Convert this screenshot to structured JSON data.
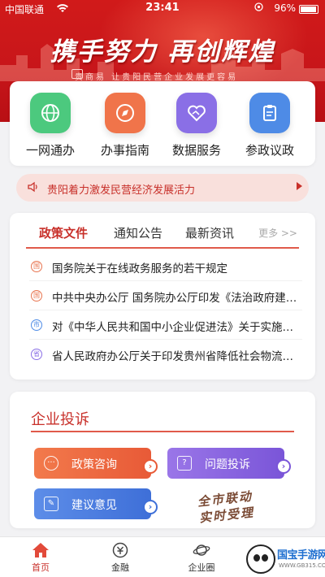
{
  "status_bar": {
    "carrier": "中国联通",
    "time": "23:41",
    "battery": "96%"
  },
  "banner": {
    "slogan": "携手努力 再创辉煌",
    "tagline": "贵商易 让贵阳民营企业发展更容易"
  },
  "services": [
    {
      "label": "一网通办",
      "icon": "globe-icon",
      "color": "#4cc97e"
    },
    {
      "label": "办事指南",
      "icon": "compass-icon",
      "color": "#f0744a"
    },
    {
      "label": "数据服务",
      "icon": "handshake-icon",
      "color": "#8a6fe6"
    },
    {
      "label": "参政议政",
      "icon": "clipboard-icon",
      "color": "#4e8be6"
    }
  ],
  "notice": {
    "text": "贵阳着力激发民营经济发展活力"
  },
  "news": {
    "tabs": [
      "政策文件",
      "通知公告",
      "最新资讯"
    ],
    "active_tab": "政策文件",
    "more": "更多 >>",
    "items": [
      {
        "badge": "国",
        "title": "国务院关于在线政务服务的若干规定",
        "color": "#e8734e"
      },
      {
        "badge": "国",
        "title": "中共中央办公厅 国务院办公厅印发《法治政府建设实施纲要》",
        "color": "#e8734e"
      },
      {
        "badge": "市",
        "title": "对《中华人民共和国中小企业促进法》关于实施情况的检查",
        "color": "#4e8be6"
      },
      {
        "badge": "省",
        "title": "省人民政府办公厅关于印发贵州省降低社会物流成本的通知",
        "color": "#8a6fe6"
      }
    ]
  },
  "complaint": {
    "title": "企业投诉",
    "buttons": [
      {
        "label": "政策咨询",
        "icon": "chat-icon"
      },
      {
        "label": "问题投诉",
        "icon": "complaint-icon"
      },
      {
        "label": "建议意见",
        "icon": "edit-icon"
      }
    ],
    "calligraphy": [
      "全市联动",
      "实时受理"
    ]
  },
  "tabbar": {
    "items": [
      {
        "label": "首页",
        "icon": "home-icon"
      },
      {
        "label": "金融",
        "icon": "finance-icon"
      },
      {
        "label": "企业圈",
        "icon": "planet-icon"
      }
    ],
    "active": "首页"
  },
  "watermark": {
    "name": "国宝手游网",
    "url": "WWW.GB315.COM"
  },
  "colors": {
    "brand_red": "#c8302a",
    "banner_red": "#d11a1a"
  }
}
